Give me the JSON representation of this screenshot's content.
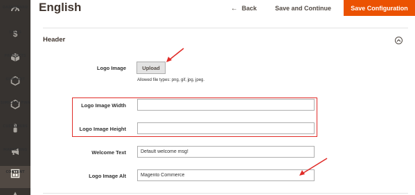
{
  "sidebar": {
    "items": [
      {
        "label": "Dashboard",
        "icon": "dashboard-icon"
      },
      {
        "label": "Sales",
        "icon": "dollar-icon"
      },
      {
        "label": "Products",
        "icon": "cube-icon"
      },
      {
        "label": "Simicart",
        "icon": "hexagon-icon"
      },
      {
        "label": "Simicart PWA",
        "icon": "hexagon-icon"
      },
      {
        "label": "Customers",
        "icon": "person-icon"
      },
      {
        "label": "Marketing",
        "icon": "megaphone-icon"
      },
      {
        "label": "Content",
        "icon": "layout-icon"
      }
    ]
  },
  "header": {
    "title": "English",
    "back_label": "Back",
    "save_continue_label": "Save and Continue",
    "save_config_label": "Save Configuration",
    "accent_color": "#eb5202"
  },
  "section": {
    "title": "Header"
  },
  "form": {
    "logo_image_label": "Logo Image",
    "upload_label": "Upload",
    "allowed_types_note": "Allowed file types: png, gif, jpg, jpeg.",
    "logo_width_label": "Logo Image Width",
    "logo_width_value": "",
    "logo_height_label": "Logo Image Height",
    "logo_height_value": "",
    "welcome_text_label": "Welcome Text",
    "welcome_text_value": "Default welcome msg!",
    "logo_alt_label": "Logo Image Alt",
    "logo_alt_value": "Magento Commerce"
  },
  "annotations": {
    "color": "#e02b27"
  }
}
